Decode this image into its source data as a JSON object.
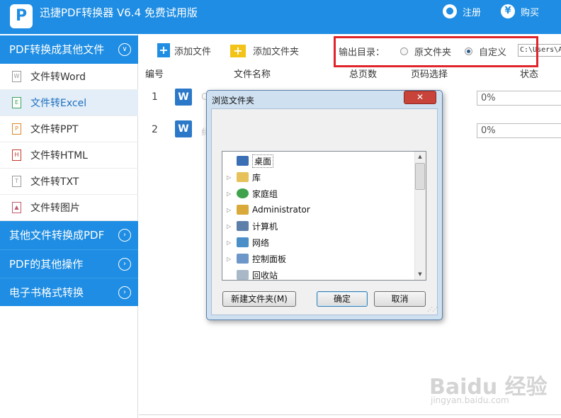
{
  "app": {
    "title": "迅捷PDF转换器 V6.4 免费试用版",
    "logo_letter": "P",
    "register_label": "注册",
    "buy_label": "购买",
    "buy_symbol": "¥",
    "accent_color": "#1e8de3"
  },
  "sidebar": {
    "section1": "PDF转换成其他文件",
    "items": [
      {
        "label": "文件转Word",
        "icon": "W"
      },
      {
        "label": "文件转Excel",
        "icon": "E"
      },
      {
        "label": "文件转PPT",
        "icon": "P"
      },
      {
        "label": "文件转HTML",
        "icon": "H"
      },
      {
        "label": "文件转TXT",
        "icon": "T"
      },
      {
        "label": "文件转图片",
        "icon": "▲"
      }
    ],
    "active_index": 1,
    "section2": "其他文件转换成PDF",
    "section3": "PDF的其他操作",
    "section4": "电子书格式转换"
  },
  "toolbar": {
    "add_file": "添加文件",
    "add_folder": "添加文件夹",
    "output_label": "输出目录：",
    "option_original": "原文件夹",
    "option_custom": "自定义",
    "selected_option": "自定义",
    "path_value": "C:\\Users\\A"
  },
  "table": {
    "headers": [
      "编号",
      "文件名称",
      "总页数",
      "页码选择",
      "状态"
    ],
    "rows": [
      {
        "no": "1",
        "name_prefix": "C",
        "progress": "0%"
      },
      {
        "no": "2",
        "name_prefix": "纠",
        "progress": "0%"
      }
    ]
  },
  "dialog": {
    "title": "浏览文件夹",
    "close": "✕",
    "tree": [
      {
        "label": "桌面",
        "icon": "desktop-icon",
        "selected": true
      },
      {
        "label": "库",
        "icon": "library-icon"
      },
      {
        "label": "家庭组",
        "icon": "homegroup-icon"
      },
      {
        "label": "Administrator",
        "icon": "user-folder-icon"
      },
      {
        "label": "计算机",
        "icon": "computer-icon"
      },
      {
        "label": "网络",
        "icon": "network-icon"
      },
      {
        "label": "控制面板",
        "icon": "control-panel-icon"
      },
      {
        "label": "回收站",
        "icon": "recycle-bin-icon"
      }
    ],
    "new_folder": "新建文件夹(M)",
    "ok": "确定",
    "cancel": "取消"
  },
  "watermark": {
    "brand": "Baidu 经验",
    "url": "jingyan.baidu.com"
  }
}
